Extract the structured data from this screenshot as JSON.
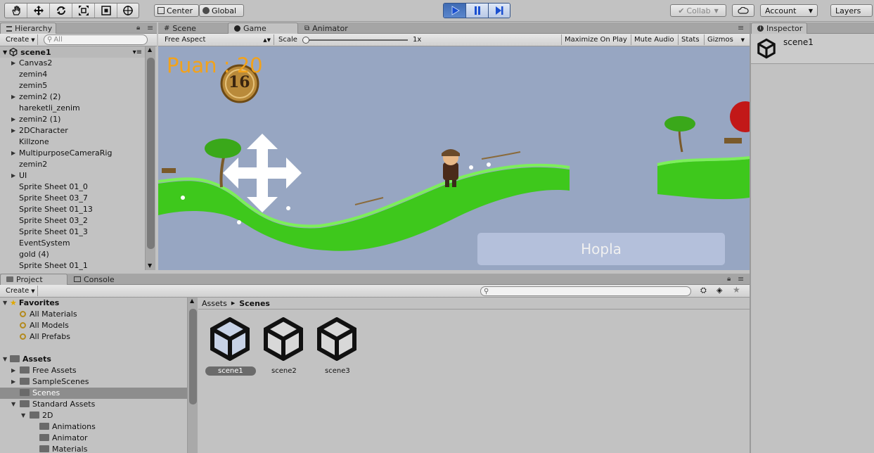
{
  "toolbar": {
    "tools": [
      "hand-tool",
      "move-tool",
      "rotate-tool",
      "scale-tool",
      "rect-tool",
      "transform-tool"
    ],
    "pivot_label": "Center",
    "space_label": "Global",
    "collab_label": "Collab",
    "account_label": "Account",
    "layers_label": "Layers"
  },
  "hierarchy": {
    "tab_label": "Hierarchy",
    "create_label": "Create",
    "search_placeholder": "All",
    "scene_name": "scene1",
    "items": [
      {
        "label": "Canvas2",
        "expandable": true
      },
      {
        "label": "zemin4",
        "expandable": false
      },
      {
        "label": "zemin5",
        "expandable": false
      },
      {
        "label": "zemin2 (2)",
        "expandable": true
      },
      {
        "label": "hareketli_zenim",
        "expandable": false
      },
      {
        "label": "zemin2 (1)",
        "expandable": true
      },
      {
        "label": "2DCharacter",
        "expandable": true
      },
      {
        "label": "Killzone",
        "expandable": false
      },
      {
        "label": "MultipurposeCameraRig",
        "expandable": true
      },
      {
        "label": "zemin2",
        "expandable": false
      },
      {
        "label": "UI",
        "expandable": true
      },
      {
        "label": "Sprite Sheet 01_0",
        "expandable": false
      },
      {
        "label": "Sprite Sheet 03_7",
        "expandable": false
      },
      {
        "label": "Sprite Sheet 01_13",
        "expandable": false
      },
      {
        "label": "Sprite Sheet 03_2",
        "expandable": false
      },
      {
        "label": "Sprite Sheet 01_3",
        "expandable": false
      },
      {
        "label": "EventSystem",
        "expandable": false
      },
      {
        "label": "gold (4)",
        "expandable": false
      },
      {
        "label": "Sprite Sheet 01_1",
        "expandable": false
      }
    ]
  },
  "game_view": {
    "tabs": [
      "Scene",
      "Game",
      "Animator"
    ],
    "active_tab": "Game",
    "aspect_label": "Free Aspect",
    "scale_label": "Scale",
    "scale_value": "1x",
    "maximize_label": "Maximize On Play",
    "mute_label": "Mute Audio",
    "stats_label": "Stats",
    "gizmos_label": "Gizmos",
    "score_text": "Puan : 20",
    "coin_value": "16",
    "jump_button_label": "Hopla",
    "colors": {
      "sky": "#97a6c2",
      "grass": "#3ec81c",
      "score": "#f2a21b"
    }
  },
  "inspector": {
    "tab_label": "Inspector",
    "object_name": "scene1"
  },
  "project": {
    "tabs": [
      "Project",
      "Console"
    ],
    "create_label": "Create",
    "favorites_label": "Favorites",
    "favorites": [
      "All Materials",
      "All Models",
      "All Prefabs"
    ],
    "assets_label": "Assets",
    "asset_tree": [
      {
        "label": "Free Assets",
        "depth": 1,
        "expanded": false
      },
      {
        "label": "SampleScenes",
        "depth": 1,
        "expanded": false
      },
      {
        "label": "Scenes",
        "depth": 1,
        "expanded": null,
        "selected": true
      },
      {
        "label": "Standard Assets",
        "depth": 1,
        "expanded": true
      },
      {
        "label": "2D",
        "depth": 2,
        "expanded": true
      },
      {
        "label": "Animations",
        "depth": 3,
        "expanded": null
      },
      {
        "label": "Animator",
        "depth": 3,
        "expanded": null
      },
      {
        "label": "Materials",
        "depth": 3,
        "expanded": null
      }
    ],
    "breadcrumb": [
      "Assets",
      "Scenes"
    ],
    "scene_files": [
      "scene1",
      "scene2",
      "scene3"
    ],
    "selected_file": "scene1"
  }
}
